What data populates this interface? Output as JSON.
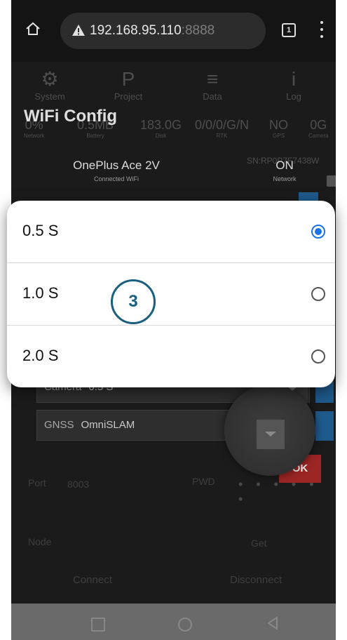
{
  "browser": {
    "url_host": "192.168.95.110",
    "url_port": ":8888",
    "tab_count": "1"
  },
  "app": {
    "tabs": [
      {
        "label": "System",
        "icon": "gear-icon",
        "glyph": "⚙"
      },
      {
        "label": "Project",
        "icon": "project-icon",
        "glyph": "P"
      },
      {
        "label": "Data",
        "icon": "database-icon",
        "glyph": "≡"
      },
      {
        "label": "Log",
        "icon": "info-icon",
        "glyph": "i"
      }
    ],
    "title": "WiFi Config",
    "stats": [
      {
        "value": "0%",
        "label": "Network"
      },
      {
        "value": "0.5MB",
        "label": "Battery"
      },
      {
        "value": "183.0G",
        "label": "Disk"
      },
      {
        "value": "0/0/0/G/N",
        "label": "RTK"
      },
      {
        "value": "NO",
        "label": "GPS"
      },
      {
        "value": "0G",
        "label": "Camera"
      }
    ],
    "sn": "SN:RP0P7F7438W",
    "wifi_name": "OnePlus Ace 2V",
    "wifi_label": "Connected WiFi",
    "network_value": "ON",
    "network_label": "Network",
    "camera_key": "Camera",
    "camera_value": "0.5 S",
    "gnss_key": "GNSS",
    "gnss_value": "OmniSLAM",
    "port_label": "Port",
    "port_value": "8003",
    "pwd_label": "PWD",
    "pwd_dots": "• • • • • •",
    "node_label": "Node",
    "get_label": "Get",
    "ok_label": "OK",
    "connect_label": "Connect",
    "disconnect_label": "Disconnect"
  },
  "dialog": {
    "options": [
      {
        "label": "0.5 S",
        "selected": true
      },
      {
        "label": "1.0 S",
        "selected": false
      },
      {
        "label": "2.0 S",
        "selected": false
      }
    ]
  },
  "step_badge": "3"
}
